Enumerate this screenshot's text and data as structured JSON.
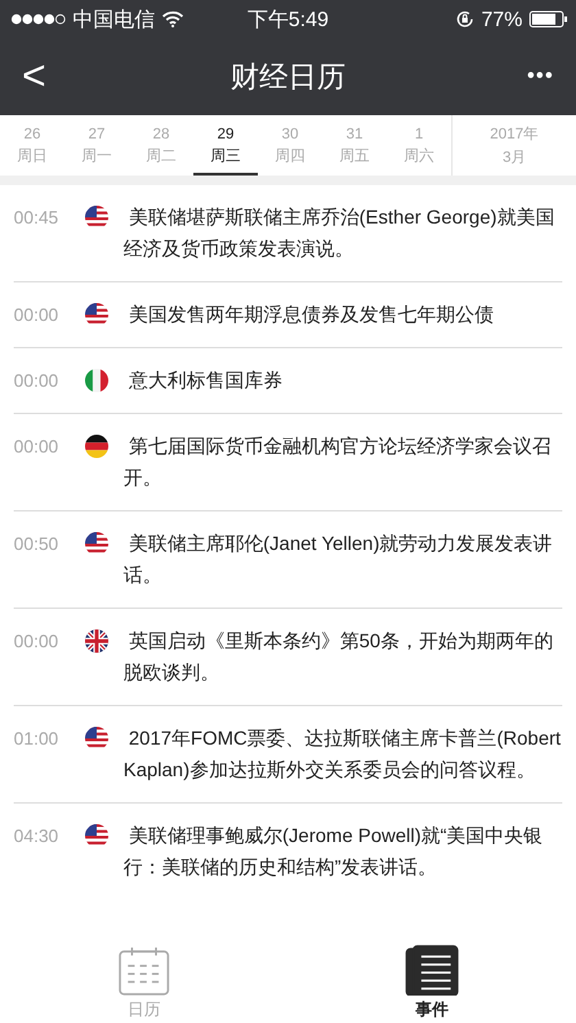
{
  "status_bar": {
    "carrier": "中国电信",
    "time": "下午5:49",
    "battery": "77%"
  },
  "nav": {
    "back": "<",
    "title": "财经日历",
    "more": "•••"
  },
  "days": [
    {
      "date": "26",
      "weekday": "周日",
      "selected": false
    },
    {
      "date": "27",
      "weekday": "周一",
      "selected": false
    },
    {
      "date": "28",
      "weekday": "周二",
      "selected": false
    },
    {
      "date": "29",
      "weekday": "周三",
      "selected": true
    },
    {
      "date": "30",
      "weekday": "周四",
      "selected": false
    },
    {
      "date": "31",
      "weekday": "周五",
      "selected": false
    },
    {
      "date": "1",
      "weekday": "周六",
      "selected": false
    }
  ],
  "month": {
    "year": "2017年",
    "month": "3月"
  },
  "events": [
    {
      "time": "00:45",
      "kind": "us",
      "text": " 美联储堪萨斯联储主席乔治(Esther George)就美国经济及货币政策发表演说。"
    },
    {
      "time": "00:00",
      "kind": "us",
      "text": " 美国发售两年期浮息债券及发售七年期公债"
    },
    {
      "time": "00:00",
      "kind": "it",
      "text": " 意大利标售国库券"
    },
    {
      "time": "00:00",
      "kind": "de",
      "text": " 第七届国际货币金融机构官方论坛经济学家会议召开。"
    },
    {
      "time": "00:50",
      "kind": "us",
      "text": " 美联储主席耶伦(Janet Yellen)就劳动力发展发表讲话。"
    },
    {
      "time": "00:00",
      "kind": "gb",
      "text": " 英国启动《里斯本条约》第50条，开始为期两年的脱欧谈判。"
    },
    {
      "time": "01:00",
      "kind": "us",
      "text": " 2017年FOMC票委、达拉斯联储主席卡普兰(Robert Kaplan)参加达拉斯外交关系委员会的问答议程。"
    },
    {
      "time": "04:30",
      "kind": "us",
      "text": " 美联储理事鲍威尔(Jerome Powell)就“美国中央银行：美联储的历史和结构”发表讲话。"
    }
  ],
  "tabs": [
    {
      "label": "日历",
      "kind": "calendar",
      "selected": false
    },
    {
      "label": "事件",
      "kind": "events",
      "selected": true
    }
  ]
}
